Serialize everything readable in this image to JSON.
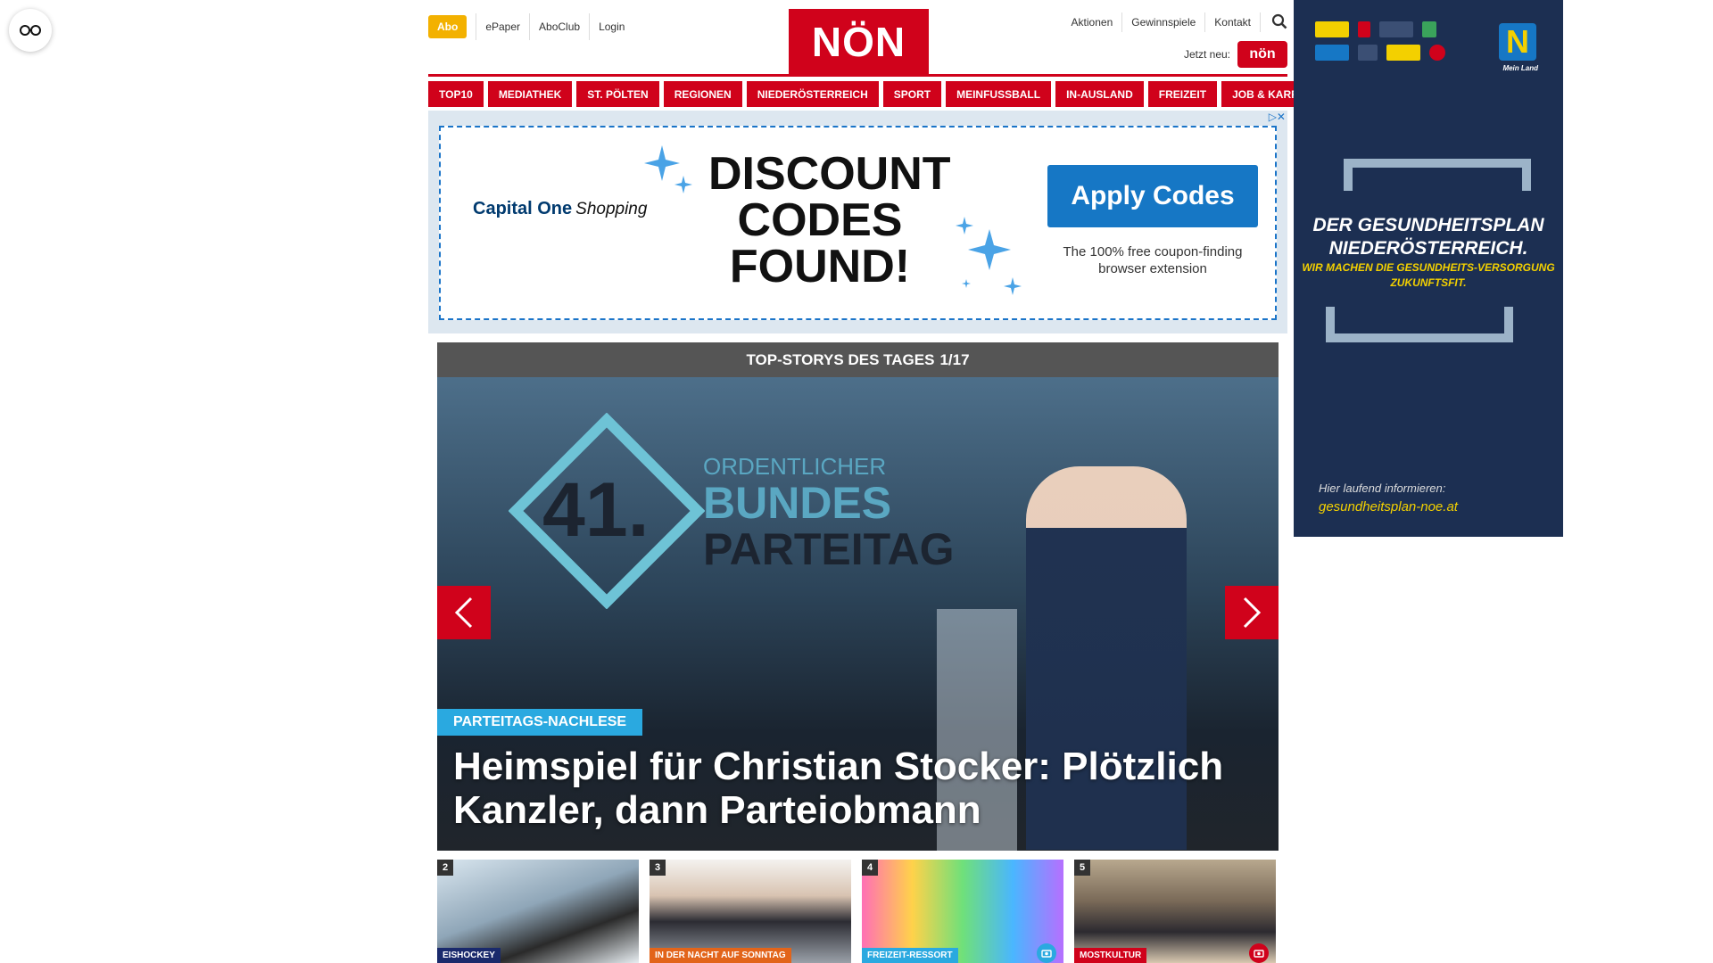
{
  "header": {
    "abo": "Abo",
    "left_links": [
      "ePaper",
      "AboClub",
      "Login"
    ],
    "logo": "NÖN",
    "right_links": [
      "Aktionen",
      "Gewinnspiele",
      "Kontakt"
    ],
    "jetzt_neu": "Jetzt neu:",
    "mini_logo": "nön"
  },
  "nav": [
    "TOP10",
    "MEDIATHEK",
    "ST. PÖLTEN",
    "REGIONEN",
    "NIEDERÖSTERREICH",
    "SPORT",
    "MEINFUSSBALL",
    "IN-AUSLAND",
    "FREIZEIT",
    "JOB & KARRIERE"
  ],
  "ad": {
    "brand": "Capital One",
    "brand_suffix": "Shopping",
    "headline": "DISCOUNT CODES FOUND!",
    "cta": "Apply Codes",
    "sub": "The 100% free coupon-finding browser extension"
  },
  "slider": {
    "header": "TOP-STORYS DES TAGES",
    "counter": "1/17",
    "screen_lines": [
      "41.",
      "ORDENTLICHER",
      "BUNDES",
      "PARTEITAG"
    ],
    "kicker": "PARTEITAGS-NACHLESE",
    "headline": "Heimspiel für Christian Stocker: Plötzlich Kanzler, dann Parteiobmann"
  },
  "thumbs": [
    {
      "num": "2",
      "tag": "EISHOCKEY"
    },
    {
      "num": "3",
      "tag": "IN DER NACHT AUF SONNTAG"
    },
    {
      "num": "4",
      "tag": "FREIZEIT-RESSORT"
    },
    {
      "num": "5",
      "tag": "MOSTKULTUR"
    }
  ],
  "side_ad": {
    "big_n": "N",
    "meinland": "Mein Land",
    "title": "DER GESUNDHEITSPLAN NIEDERÖSTERREICH.",
    "sub": "WIR MACHEN DIE GESUNDHEITS-VERSORGUNG ZUKUNFTSFIT.",
    "info": "Hier laufend informieren:",
    "url": "gesundheitsplan-noe.at"
  },
  "colors": {
    "brand_red": "#d0021b",
    "abo_yellow": "#f3b100",
    "kicker_blue": "#2aa9e0",
    "side_ad_bg": "#1c2f52"
  }
}
